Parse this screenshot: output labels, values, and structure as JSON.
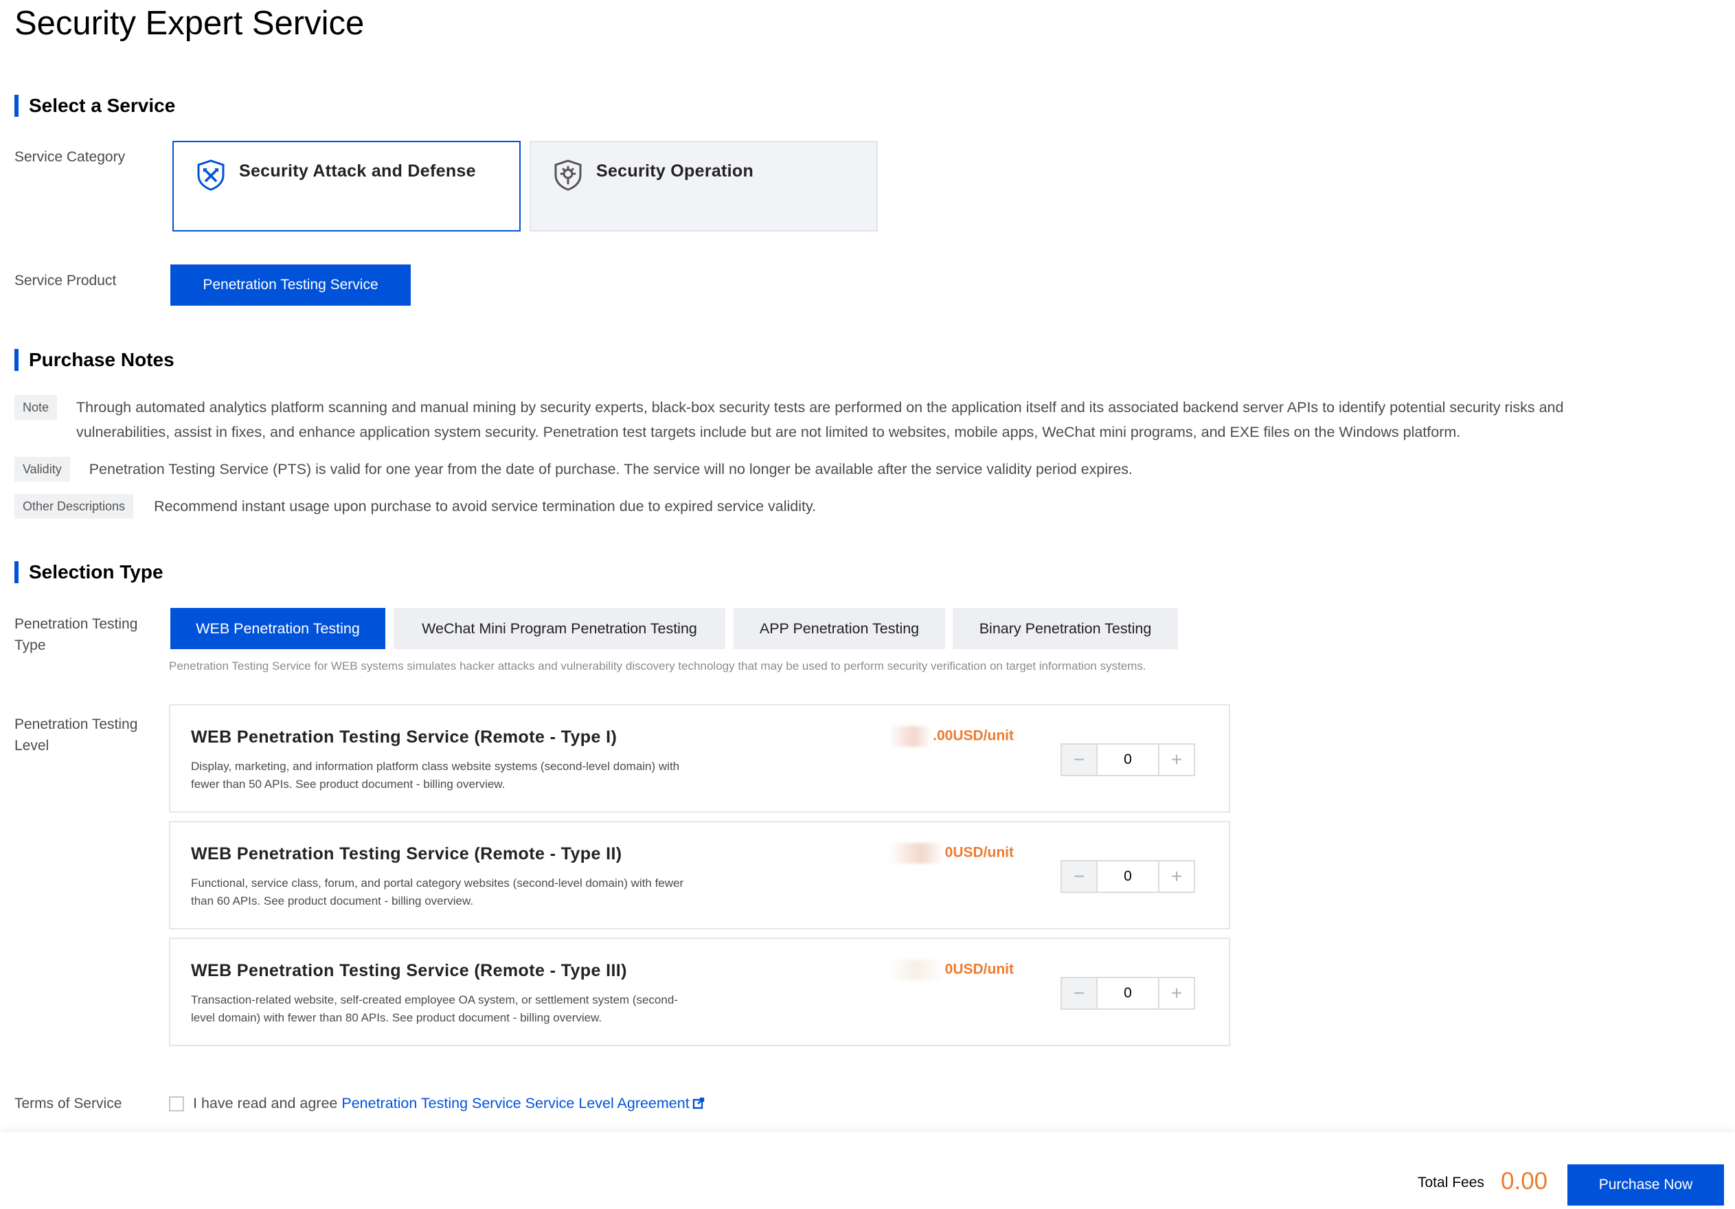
{
  "page": {
    "title": "Security Expert Service"
  },
  "sections": {
    "select_service": "Select a Service",
    "purchase_notes": "Purchase Notes",
    "selection_type": "Selection Type"
  },
  "labels": {
    "service_category": "Service Category",
    "service_product": "Service Product",
    "pt_type_line1": "Penetration Testing",
    "pt_type_line2": "Type",
    "pt_level_line1": "Penetration Testing",
    "pt_level_line2": "Level",
    "terms_of_service": "Terms of Service"
  },
  "categories": [
    {
      "label": "Security Attack and Defense",
      "icon": "shield-swords-icon",
      "selected": true
    },
    {
      "label": "Security Operation",
      "icon": "shield-gear-icon",
      "selected": false
    }
  ],
  "product": {
    "label": "Penetration Testing Service",
    "selected": true
  },
  "notes": [
    {
      "tag": "Note",
      "text_line1": "Through automated analytics platform scanning and manual mining by security experts, black-box security tests are performed on the application itself and its associated backend server APIs to identify potential security risks and",
      "text_line2": "vulnerabilities, assist in fixes, and enhance application system security. Penetration test targets include but are not limited to websites, mobile apps, WeChat mini programs, and EXE files on the Windows platform."
    },
    {
      "tag": "Validity",
      "text": "Penetration Testing Service (PTS) is valid for one year from the date of purchase. The service will no longer be available after the service validity period expires."
    },
    {
      "tag": "Other Descriptions",
      "text": "Recommend instant usage upon purchase to avoid service termination due to expired service validity."
    }
  ],
  "type_tabs": [
    {
      "label": "WEB Penetration Testing",
      "selected": true
    },
    {
      "label": "WeChat Mini Program Penetration Testing",
      "selected": false
    },
    {
      "label": "APP Penetration Testing",
      "selected": false
    },
    {
      "label": "Binary Penetration Testing",
      "selected": false
    }
  ],
  "type_description": "Penetration Testing Service for WEB systems simulates hacker attacks and vulnerability discovery technology that may be used to perform security verification on target information systems.",
  "services": [
    {
      "name": "WEB Penetration Testing Service (Remote - Type I)",
      "desc_line1": "Display, marketing, and information platform class website systems (second-level domain) with",
      "desc_line2": "fewer than 50 APIs. See product document - billing overview.",
      "price_suffix": ".00USD/unit",
      "quantity": "0"
    },
    {
      "name": "WEB Penetration Testing Service (Remote - Type II)",
      "desc_line1": "Functional, service class, forum, and portal category websites (second-level domain) with fewer",
      "desc_line2": "than 60 APIs. See product document - billing overview.",
      "price_suffix": "0USD/unit",
      "quantity": "0"
    },
    {
      "name": "WEB Penetration Testing Service (Remote - Type III)",
      "desc_line1": "Transaction-related website, self-created employee OA system, or settlement system (second-",
      "desc_line2": "level domain) with fewer than 80 APIs. See product document - billing overview.",
      "price_suffix": "0USD/unit",
      "quantity": "0"
    }
  ],
  "stepper": {
    "minus": "−",
    "plus": "+"
  },
  "terms": {
    "checked": false,
    "prefix": "I have read and agree ",
    "link": "Penetration Testing Service Service Level Agreement",
    "link_icon": "external-link-icon"
  },
  "footer": {
    "total_label": "Total Fees",
    "total_value": "0.00",
    "purchase_label": "Purchase Now"
  },
  "colors": {
    "primary": "#0052d9",
    "price": "#ed7b2f",
    "tab_bg": "#eeeff2",
    "border": "#e5e6ea"
  }
}
